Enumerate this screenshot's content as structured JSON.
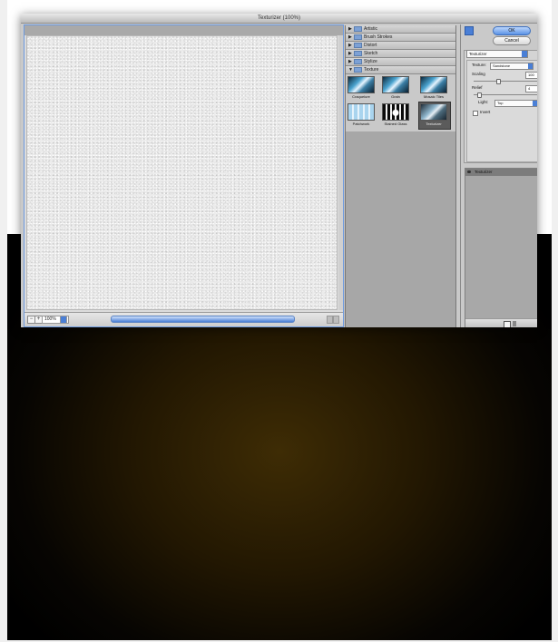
{
  "window": {
    "title": "Texturizer (100%)"
  },
  "preview": {
    "zoom": "100%",
    "zoom_out": "−",
    "zoom_in": "+"
  },
  "categories": [
    {
      "label": "Artistic",
      "expanded": false
    },
    {
      "label": "Brush Strokes",
      "expanded": false
    },
    {
      "label": "Distort",
      "expanded": false
    },
    {
      "label": "Sketch",
      "expanded": false
    },
    {
      "label": "Stylize",
      "expanded": false
    },
    {
      "label": "Texture",
      "expanded": true
    }
  ],
  "texture_filters": [
    {
      "label": "Craquelure",
      "icon": "craquelure-thumbnail"
    },
    {
      "label": "Grain",
      "icon": "grain-thumbnail"
    },
    {
      "label": "Mosaic Tiles",
      "icon": "mosaic-tiles-thumbnail"
    },
    {
      "label": "Patchwork",
      "icon": "patchwork-thumbnail"
    },
    {
      "label": "Stained Glass",
      "icon": "stained-glass-thumbnail"
    },
    {
      "label": "Texturizer",
      "icon": "texturizer-thumbnail",
      "selected": true
    }
  ],
  "buttons": {
    "ok": "OK",
    "cancel": "Cancel"
  },
  "settings": {
    "filter": "Texturizer",
    "texture_label": "Texture:",
    "texture_value": "Sandstone",
    "scaling_label": "Scaling",
    "scaling_value": "100",
    "scaling_unit": "%",
    "scaling_level": 0.35,
    "relief_label": "Relief",
    "relief_value": "4",
    "relief_level": 0.08,
    "light_label": "Light:",
    "light_value": "Top",
    "invert_label": "Invert",
    "invert_checked": false
  },
  "layers": [
    {
      "label": "Texturizer",
      "visible": true
    }
  ],
  "colors": {
    "accent": "#4a7fd6",
    "panel": "#c9c9c9",
    "background_glow": "#3e2c05"
  }
}
